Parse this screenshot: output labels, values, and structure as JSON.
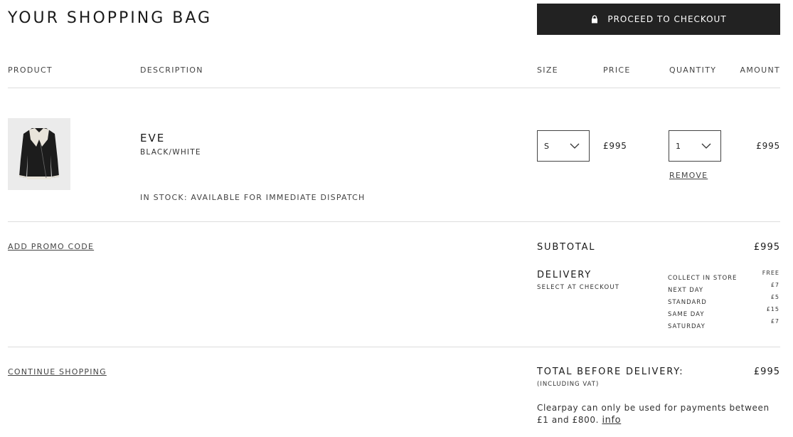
{
  "page": {
    "title": "YOUR SHOPPING BAG",
    "checkout_button": "PROCEED TO CHECKOUT",
    "lock_icon": "lock-icon"
  },
  "columns": {
    "product": "PRODUCT",
    "description": "DESCRIPTION",
    "size": "SIZE",
    "price": "PRICE",
    "quantity": "QUANTITY",
    "amount": "AMOUNT"
  },
  "item": {
    "name": "EVE",
    "variant": "BLACK/WHITE",
    "stock": "IN STOCK: AVAILABLE FOR IMMEDIATE DISPATCH",
    "size": "S",
    "price": "£995",
    "quantity": "1",
    "amount": "£995",
    "remove": "REMOVE",
    "image_icon": "leather-jacket-image"
  },
  "summary": {
    "promo_link": "ADD PROMO CODE",
    "subtotal_label": "SUBTOTAL",
    "subtotal_value": "£995",
    "delivery_label": "DELIVERY",
    "delivery_sub": "SELECT AT CHECKOUT",
    "delivery_options": [
      {
        "name": "COLLECT IN STORE",
        "price": "FREE"
      },
      {
        "name": "NEXT DAY",
        "price": "£7"
      },
      {
        "name": "STANDARD",
        "price": "£5"
      },
      {
        "name": "SAME DAY",
        "price": "£15"
      },
      {
        "name": "SATURDAY",
        "price": "£7"
      }
    ],
    "continue_link": "CONTINUE SHOPPING",
    "total_label": "TOTAL BEFORE DELIVERY:",
    "total_value": "£995",
    "vat_note": "(INCLUDING VAT)",
    "clearpay_text": "Clearpay can only be used for payments between £1 and £800.",
    "clearpay_link": "info"
  }
}
